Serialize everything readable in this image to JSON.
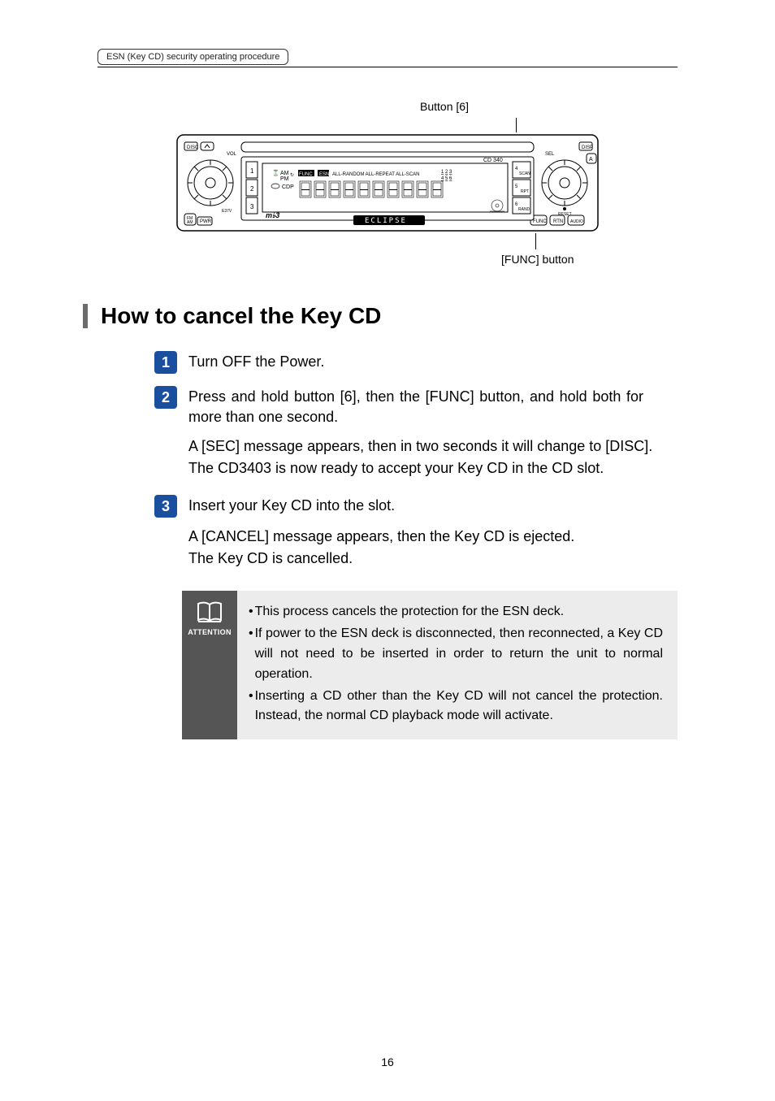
{
  "breadcrumb": "ESN (Key CD) security operating procedure",
  "diagram": {
    "label_top": "Button [6]",
    "label_bottom": "[FUNC] button",
    "brand": "ECLIPSE",
    "model": "CD 340"
  },
  "section_title": "How to cancel the Key CD",
  "steps": [
    {
      "num": "1",
      "title": "Turn OFF the Power.",
      "sub": ""
    },
    {
      "num": "2",
      "title": "Press and hold button [6], then the [FUNC] button, and hold both for more than one second.",
      "sub": "A [SEC] message appears, then in two seconds it will change to [DISC].\nThe CD3403 is now ready to accept your Key CD in the CD slot."
    },
    {
      "num": "3",
      "title": "Insert your Key CD into the slot.",
      "sub": "A [CANCEL] message appears, then the Key CD is ejected.\nThe Key CD is cancelled."
    }
  ],
  "attention": {
    "label": "ATTENTION",
    "bullets": [
      "This process cancels the protection for the ESN deck.",
      "If power to the ESN deck is disconnected, then reconnected, a Key CD will not need to be inserted in order to return the unit to normal operation.",
      "Inserting a CD other than the Key CD will not cancel the protection. Instead, the normal CD playback mode will activate."
    ]
  },
  "page_number": "16"
}
